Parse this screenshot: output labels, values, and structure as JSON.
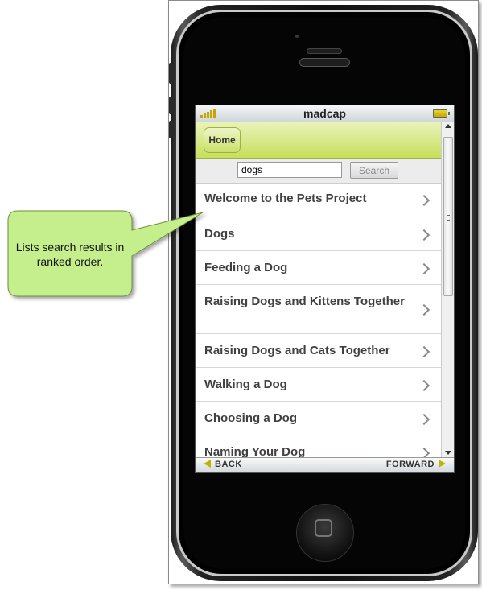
{
  "app": {
    "title": "madcap"
  },
  "navbar": {
    "home_label": "Home"
  },
  "search": {
    "value": "dogs",
    "button_label": "Search"
  },
  "results": [
    {
      "label": "Welcome to the Pets Project"
    },
    {
      "label": "Dogs"
    },
    {
      "label": "Feeding a Dog"
    },
    {
      "label": "Raising Dogs and Kittens Together"
    },
    {
      "label": "Raising Dogs and Cats Together"
    },
    {
      "label": "Walking a Dog"
    },
    {
      "label": "Choosing a Dog"
    },
    {
      "label": "Naming Your Dog"
    }
  ],
  "bottombar": {
    "back_label": "BACK",
    "forward_label": "FORWARD"
  },
  "callout": {
    "text": "Lists search results in ranked order."
  },
  "colors": {
    "accent": "#c6df5c",
    "callout_fill": "#c5ef8c",
    "arrow": "#b8b800"
  }
}
